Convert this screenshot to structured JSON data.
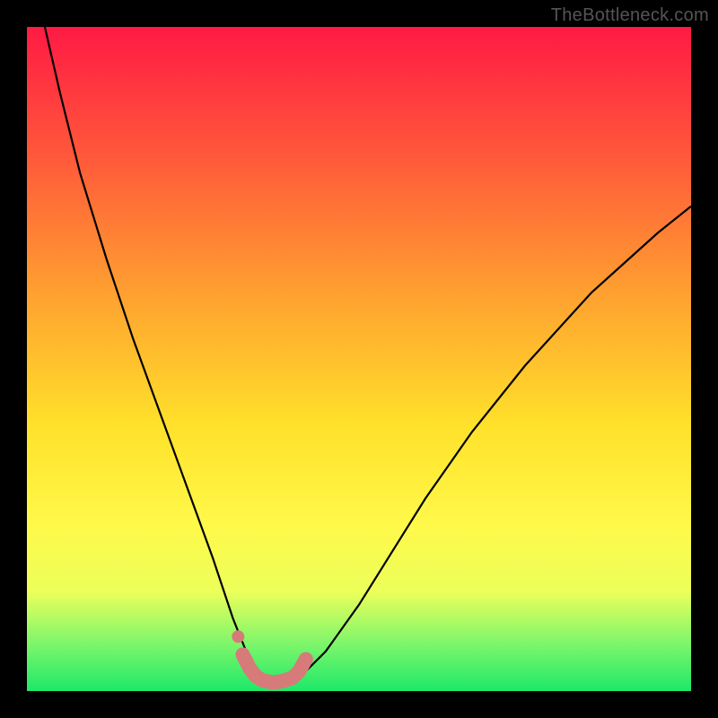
{
  "watermark": "TheBottleneck.com",
  "chart_data": {
    "type": "line",
    "title": "",
    "xlabel": "",
    "ylabel": "",
    "xlim": [
      0,
      100
    ],
    "ylim": [
      0,
      100
    ],
    "series": [
      {
        "name": "bottleneck-curve",
        "x": [
          2,
          5,
          8,
          12,
          16,
          20,
          24,
          28,
          31,
          33,
          34.5,
          36,
          38,
          40,
          42,
          45,
          50,
          55,
          60,
          67,
          75,
          85,
          95,
          100
        ],
        "values": [
          103,
          90,
          78,
          65,
          53,
          42,
          31,
          20,
          11,
          6,
          3,
          1.5,
          1.2,
          1.5,
          3,
          6,
          13,
          21,
          29,
          39,
          49,
          60,
          69,
          73
        ]
      },
      {
        "name": "highlight-band",
        "x": [
          32.5,
          33.5,
          34.5,
          35.5,
          37,
          38.5,
          40,
          41,
          42
        ],
        "values": [
          5.5,
          3.5,
          2.2,
          1.6,
          1.3,
          1.5,
          2.0,
          3.0,
          4.8
        ]
      },
      {
        "name": "highlight-dot",
        "x": [
          31.8
        ],
        "values": [
          8.2
        ]
      }
    ],
    "colors": {
      "curve": "#000000",
      "highlight": "#d77a7a",
      "gradient_top": "#ff1a44",
      "gradient_bottom": "#1de86a"
    }
  }
}
